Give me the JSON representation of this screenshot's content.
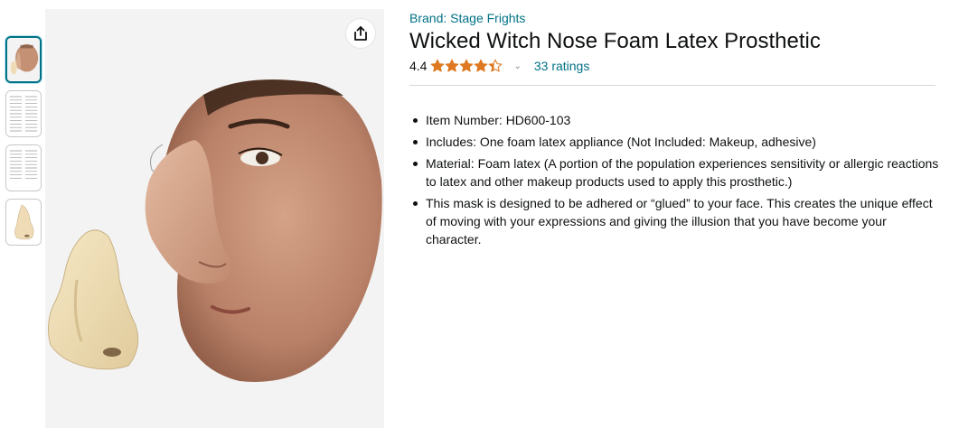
{
  "product": {
    "brand": "Brand: Stage Frights",
    "title": "Wicked Witch Nose Foam Latex Prosthetic",
    "rating_value": "4.4",
    "rating_stars": 4.4,
    "ratings_count": "33 ratings"
  },
  "bullets": [
    "Item Number: HD600-103",
    "Includes: One foam latex appliance (Not Included: Makeup, adhesive)",
    "Material: Foam latex (A portion of the population experiences sensitivity or allergic reactions to latex and other makeup products used to apply this prosthetic.)",
    "This mask is designed to be adhered or “glued” to your face. This creates the unique effect of moving with your expressions and giving the illusion that you have become your character."
  ],
  "thumbnails": [
    {
      "icon": "face-with-nose-photo",
      "selected": true
    },
    {
      "icon": "instruction-sheet-image",
      "selected": false
    },
    {
      "icon": "instruction-sheet-image",
      "selected": false
    },
    {
      "icon": "foam-nose-photo",
      "selected": false
    }
  ],
  "icons": {
    "share": "share-icon",
    "star": "star-icon",
    "caret": "chevron-down-icon"
  },
  "colors": {
    "link": "#007185",
    "star": "#de7921",
    "text": "#0f1111"
  }
}
